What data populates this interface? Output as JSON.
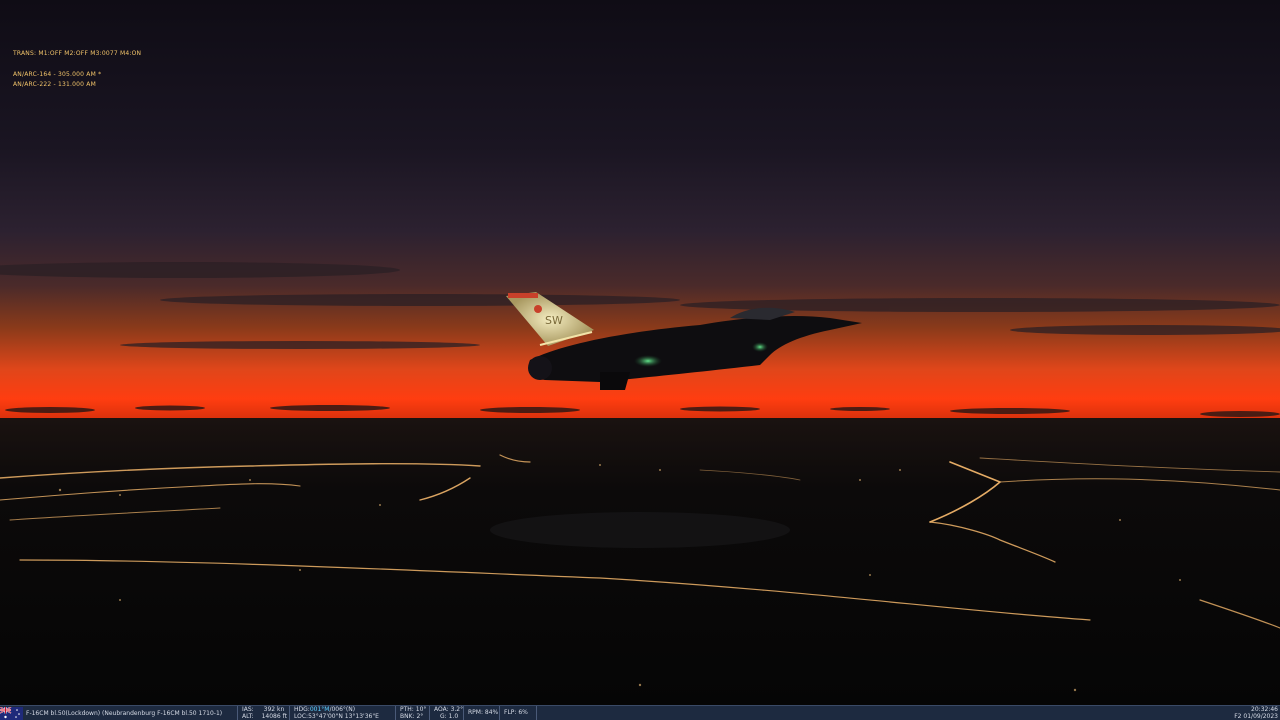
{
  "hud": {
    "trans": "TRANS: M1:OFF M2:OFF M3:0077 M4:ON",
    "radio1": "AN/ARC-164 - 305.000 AM *",
    "radio2": "AN/ARC-222 - 131.000 AM"
  },
  "aircraft": {
    "tail_code": "SW"
  },
  "statusbar": {
    "unit": "F-16CM bl.50(Lockdown) (Neubrandenburg  F-16CM bl.50  1710-1)",
    "ias_label": "IAS:",
    "ias_value": "392 kn",
    "alt_label": "ALT:",
    "alt_value": "14086 ft",
    "hdg_label": "HDG:",
    "hdg_value_a": "001°M",
    "hdg_value_b": "/006°(N)",
    "loc_label": "LOC:",
    "loc_value": "53°47'00\"N 13°13'36\"E",
    "pth_label": "PTH:",
    "pth_value": "10°",
    "bnk_label": "BNK:",
    "bnk_value": "2°",
    "aoa_label": "AOA:",
    "aoa_value": "3.2°",
    "g_label": "G:",
    "g_value": "1.0",
    "rpm_label": "RPM:",
    "rpm_value": "84%",
    "flp_label": "FLP:",
    "flp_value": "6%",
    "time": "20:32:46",
    "date": "F2 01/09/2023"
  }
}
